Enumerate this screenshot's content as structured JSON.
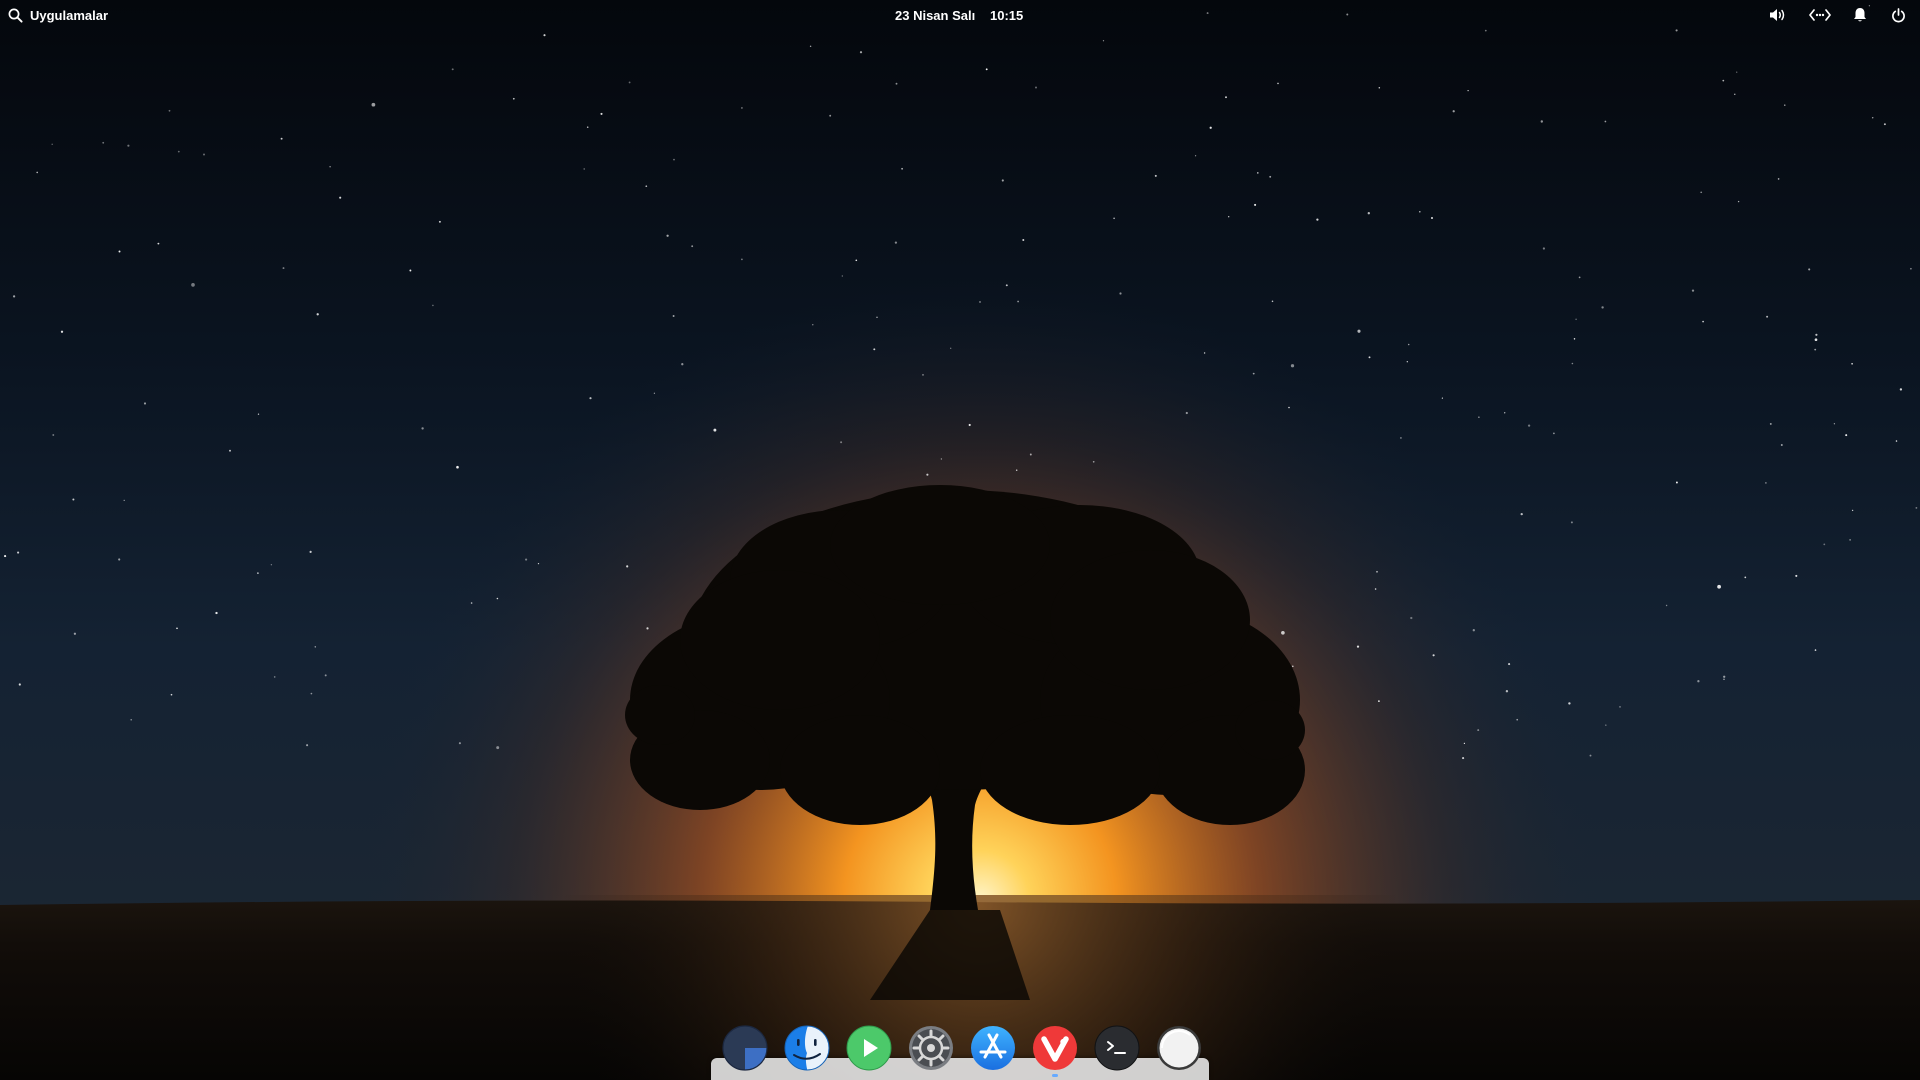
{
  "panel": {
    "applications_label": "Uygulamalar",
    "date": "23 Nisan Salı",
    "time": "10:15",
    "indicators": {
      "sound": "speaker-icon",
      "network": "network-wired-icon",
      "notifications": "bell-icon",
      "session": "power-icon"
    }
  },
  "dock": {
    "items": [
      {
        "id": "multitasking-view",
        "icon": "multitasking-view-icon",
        "running": false
      },
      {
        "id": "files",
        "icon": "finder-face-icon",
        "running": false
      },
      {
        "id": "videos",
        "icon": "play-icon",
        "running": false
      },
      {
        "id": "system-settings",
        "icon": "gear-icon",
        "running": false
      },
      {
        "id": "app-center",
        "icon": "app-store-icon",
        "running": false
      },
      {
        "id": "vivaldi",
        "icon": "vivaldi-icon",
        "running": true
      },
      {
        "id": "terminal",
        "icon": "terminal-icon",
        "running": false
      },
      {
        "id": "show-desktop",
        "icon": "white-circle-icon",
        "running": false
      }
    ]
  },
  "colors": {
    "panel_text": "#ffffff",
    "dock_surface": "#e1e1e1",
    "running_indicator": "#66aaff",
    "sky_top": "#04070c",
    "horizon_glow": "#ff9a1f"
  }
}
